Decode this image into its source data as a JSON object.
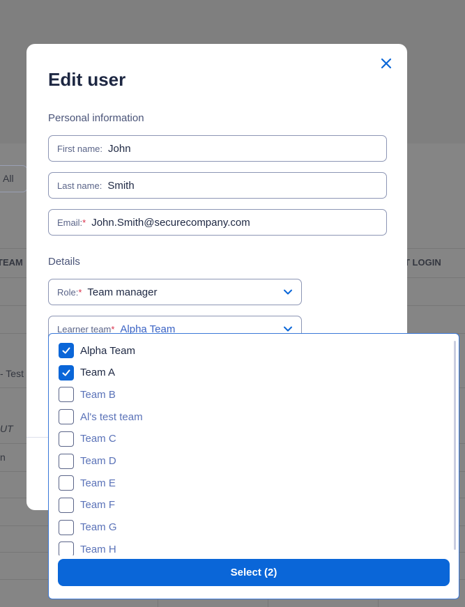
{
  "background": {
    "filter_label": "All",
    "col_team": "TEAM",
    "col_last_login": "T LOGIN",
    "row_text_1": "- Test",
    "row_text_2": "UT",
    "row_text_3": "n"
  },
  "modal": {
    "title": "Edit user",
    "personal_section": "Personal information",
    "first_name": {
      "label": "First name:",
      "value": "John"
    },
    "last_name": {
      "label": "Last name:",
      "value": "Smith"
    },
    "email": {
      "label": "Email:",
      "required": "*",
      "value": "John.Smith@securecompany.com"
    },
    "details_section": "Details",
    "role": {
      "label": "Role:",
      "required": "*",
      "value": "Team manager"
    },
    "learner_team": {
      "label": "Learner team",
      "required": "*",
      "value": "Alpha Team"
    }
  },
  "dropdown": {
    "options": [
      {
        "label": "Alpha Team",
        "checked": true
      },
      {
        "label": "Team A",
        "checked": true
      },
      {
        "label": "Team B",
        "checked": false
      },
      {
        "label": "Al's test team",
        "checked": false
      },
      {
        "label": "Team C",
        "checked": false
      },
      {
        "label": "Team D",
        "checked": false
      },
      {
        "label": "Team E",
        "checked": false
      },
      {
        "label": "Team F",
        "checked": false
      },
      {
        "label": "Team G",
        "checked": false
      },
      {
        "label": "Team H",
        "checked": false
      }
    ],
    "select_label": "Select (2)"
  },
  "colors": {
    "accent": "#0a66d8",
    "title": "#1d2742",
    "required": "#d8304a"
  }
}
